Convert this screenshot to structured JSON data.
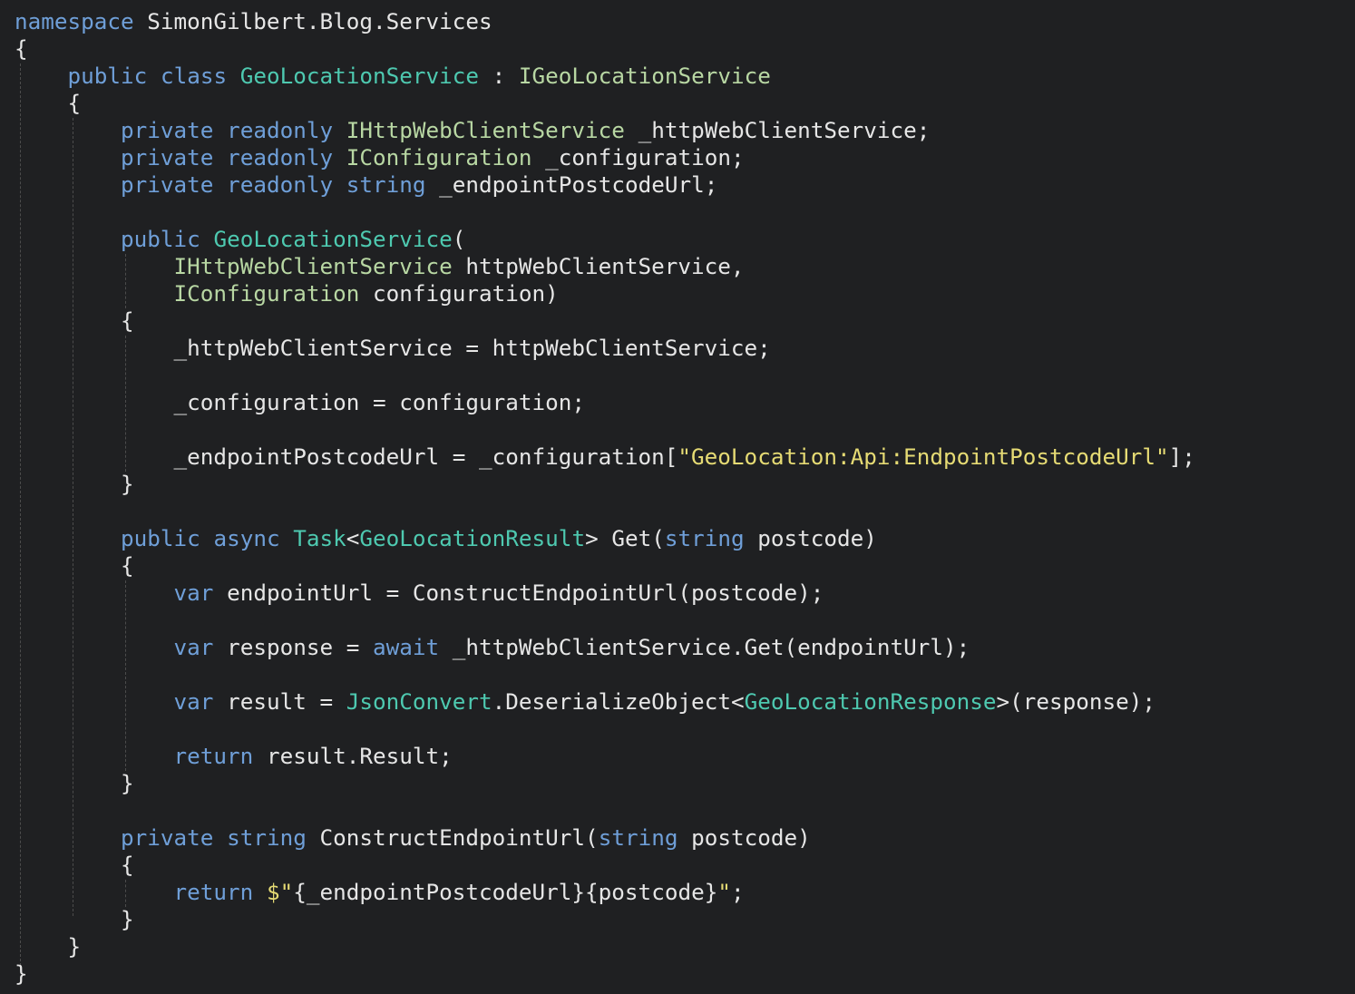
{
  "editor": {
    "theme": {
      "background": "#1f2022",
      "default": "#e6e6e6",
      "keyword": "#6f9fd8",
      "type": "#4ec9b0",
      "interface": "#b8d7a3",
      "string": "#e6db74"
    },
    "lines": [
      {
        "indent": 0,
        "tokens": [
          {
            "k": "kw",
            "t": "namespace"
          },
          {
            "k": "id",
            "t": " SimonGilbert.Blog.Services"
          }
        ]
      },
      {
        "indent": 0,
        "tokens": [
          {
            "k": "pun",
            "t": "{"
          }
        ]
      },
      {
        "indent": 1,
        "tokens": [
          {
            "k": "kw",
            "t": "public"
          },
          {
            "k": "id",
            "t": " "
          },
          {
            "k": "kw",
            "t": "class"
          },
          {
            "k": "id",
            "t": " "
          },
          {
            "k": "type",
            "t": "GeoLocationService"
          },
          {
            "k": "pun",
            "t": " : "
          },
          {
            "k": "itf",
            "t": "IGeoLocationService"
          }
        ]
      },
      {
        "indent": 1,
        "tokens": [
          {
            "k": "pun",
            "t": "{"
          }
        ]
      },
      {
        "indent": 2,
        "tokens": [
          {
            "k": "kw",
            "t": "private"
          },
          {
            "k": "id",
            "t": " "
          },
          {
            "k": "kw",
            "t": "readonly"
          },
          {
            "k": "id",
            "t": " "
          },
          {
            "k": "itf",
            "t": "IHttpWebClientService"
          },
          {
            "k": "id",
            "t": " _httpWebClientService;"
          }
        ]
      },
      {
        "indent": 2,
        "tokens": [
          {
            "k": "kw",
            "t": "private"
          },
          {
            "k": "id",
            "t": " "
          },
          {
            "k": "kw",
            "t": "readonly"
          },
          {
            "k": "id",
            "t": " "
          },
          {
            "k": "itf",
            "t": "IConfiguration"
          },
          {
            "k": "id",
            "t": " _configuration;"
          }
        ]
      },
      {
        "indent": 2,
        "tokens": [
          {
            "k": "kw",
            "t": "private"
          },
          {
            "k": "id",
            "t": " "
          },
          {
            "k": "kw",
            "t": "readonly"
          },
          {
            "k": "id",
            "t": " "
          },
          {
            "k": "kw",
            "t": "string"
          },
          {
            "k": "id",
            "t": " _endpointPostcodeUrl;"
          }
        ]
      },
      {
        "indent": 0,
        "tokens": []
      },
      {
        "indent": 2,
        "tokens": [
          {
            "k": "kw",
            "t": "public"
          },
          {
            "k": "id",
            "t": " "
          },
          {
            "k": "type",
            "t": "GeoLocationService"
          },
          {
            "k": "pun",
            "t": "("
          }
        ]
      },
      {
        "indent": 3,
        "tokens": [
          {
            "k": "itf",
            "t": "IHttpWebClientService"
          },
          {
            "k": "id",
            "t": " httpWebClientService,"
          }
        ]
      },
      {
        "indent": 3,
        "tokens": [
          {
            "k": "itf",
            "t": "IConfiguration"
          },
          {
            "k": "id",
            "t": " configuration)"
          }
        ]
      },
      {
        "indent": 2,
        "tokens": [
          {
            "k": "pun",
            "t": "{"
          }
        ]
      },
      {
        "indent": 3,
        "tokens": [
          {
            "k": "id",
            "t": "_httpWebClientService = httpWebClientService;"
          }
        ]
      },
      {
        "indent": 0,
        "tokens": []
      },
      {
        "indent": 3,
        "tokens": [
          {
            "k": "id",
            "t": "_configuration = configuration;"
          }
        ]
      },
      {
        "indent": 0,
        "tokens": []
      },
      {
        "indent": 3,
        "tokens": [
          {
            "k": "id",
            "t": "_endpointPostcodeUrl = _configuration["
          },
          {
            "k": "str",
            "t": "\"GeoLocation:Api:EndpointPostcodeUrl\""
          },
          {
            "k": "id",
            "t": "];"
          }
        ]
      },
      {
        "indent": 2,
        "tokens": [
          {
            "k": "pun",
            "t": "}"
          }
        ]
      },
      {
        "indent": 0,
        "tokens": []
      },
      {
        "indent": 2,
        "tokens": [
          {
            "k": "kw",
            "t": "public"
          },
          {
            "k": "id",
            "t": " "
          },
          {
            "k": "kw",
            "t": "async"
          },
          {
            "k": "id",
            "t": " "
          },
          {
            "k": "type",
            "t": "Task"
          },
          {
            "k": "pun",
            "t": "<"
          },
          {
            "k": "type",
            "t": "GeoLocationResult"
          },
          {
            "k": "pun",
            "t": "> Get("
          },
          {
            "k": "kw",
            "t": "string"
          },
          {
            "k": "id",
            "t": " postcode)"
          }
        ]
      },
      {
        "indent": 2,
        "tokens": [
          {
            "k": "pun",
            "t": "{"
          }
        ]
      },
      {
        "indent": 3,
        "tokens": [
          {
            "k": "kw",
            "t": "var"
          },
          {
            "k": "id",
            "t": " endpointUrl = ConstructEndpointUrl(postcode);"
          }
        ]
      },
      {
        "indent": 0,
        "tokens": []
      },
      {
        "indent": 3,
        "tokens": [
          {
            "k": "kw",
            "t": "var"
          },
          {
            "k": "id",
            "t": " response = "
          },
          {
            "k": "kw",
            "t": "await"
          },
          {
            "k": "id",
            "t": " _httpWebClientService.Get(endpointUrl);"
          }
        ]
      },
      {
        "indent": 0,
        "tokens": []
      },
      {
        "indent": 3,
        "tokens": [
          {
            "k": "kw",
            "t": "var"
          },
          {
            "k": "id",
            "t": " result = "
          },
          {
            "k": "type",
            "t": "JsonConvert"
          },
          {
            "k": "id",
            "t": ".DeserializeObject<"
          },
          {
            "k": "type",
            "t": "GeoLocationResponse"
          },
          {
            "k": "id",
            "t": ">(response);"
          }
        ]
      },
      {
        "indent": 0,
        "tokens": []
      },
      {
        "indent": 3,
        "tokens": [
          {
            "k": "kw",
            "t": "return"
          },
          {
            "k": "id",
            "t": " result.Result;"
          }
        ]
      },
      {
        "indent": 2,
        "tokens": [
          {
            "k": "pun",
            "t": "}"
          }
        ]
      },
      {
        "indent": 0,
        "tokens": []
      },
      {
        "indent": 2,
        "tokens": [
          {
            "k": "kw",
            "t": "private"
          },
          {
            "k": "id",
            "t": " "
          },
          {
            "k": "kw",
            "t": "string"
          },
          {
            "k": "id",
            "t": " ConstructEndpointUrl("
          },
          {
            "k": "kw",
            "t": "string"
          },
          {
            "k": "id",
            "t": " postcode)"
          }
        ]
      },
      {
        "indent": 2,
        "tokens": [
          {
            "k": "pun",
            "t": "{"
          }
        ]
      },
      {
        "indent": 3,
        "tokens": [
          {
            "k": "kw",
            "t": "return"
          },
          {
            "k": "id",
            "t": " "
          },
          {
            "k": "esc",
            "t": "$\""
          },
          {
            "k": "id",
            "t": "{_endpointPostcodeUrl}{postcode}"
          },
          {
            "k": "esc",
            "t": "\""
          },
          {
            "k": "id",
            "t": ";"
          }
        ]
      },
      {
        "indent": 2,
        "tokens": [
          {
            "k": "pun",
            "t": "}"
          }
        ]
      },
      {
        "indent": 1,
        "tokens": [
          {
            "k": "pun",
            "t": "}"
          }
        ]
      },
      {
        "indent": 0,
        "tokens": [
          {
            "k": "pun",
            "t": "}"
          }
        ]
      }
    ]
  }
}
